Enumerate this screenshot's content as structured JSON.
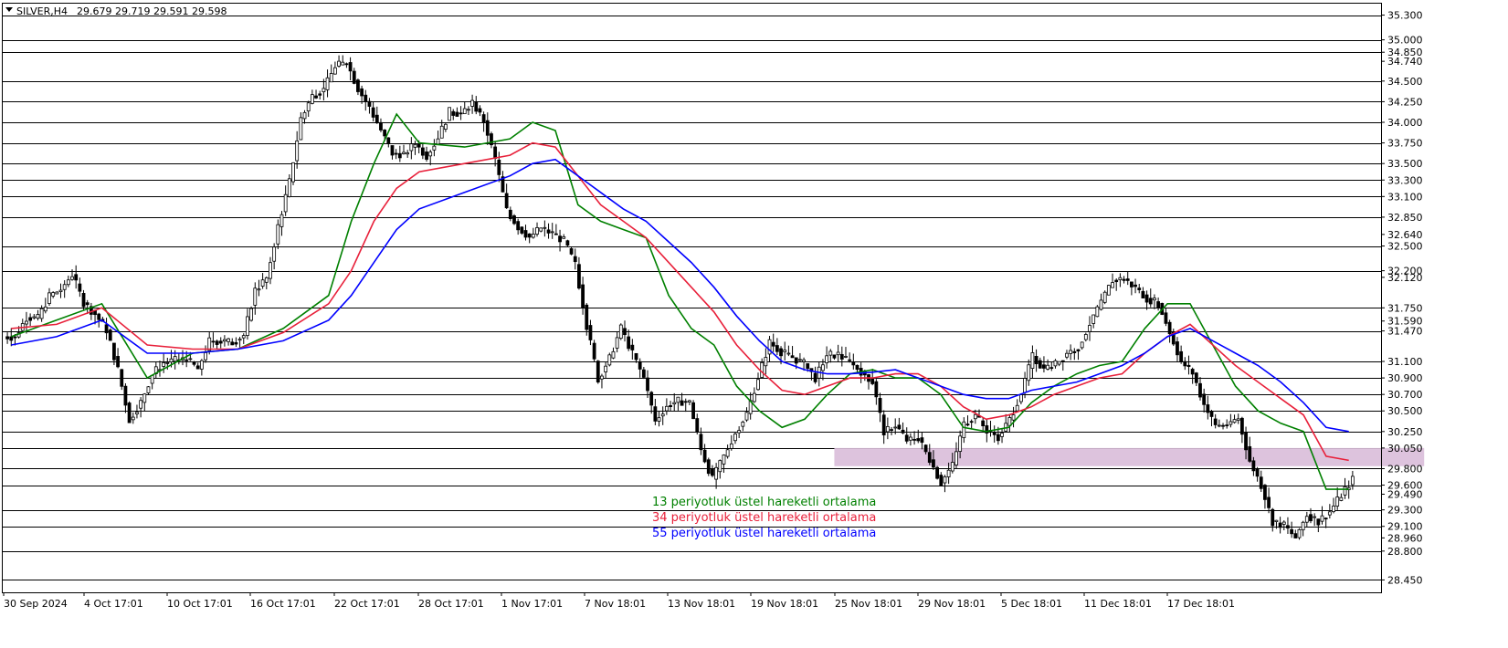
{
  "header": {
    "symbol": "SILVER,H4",
    "ohlc": "29.679 29.719 29.591 29.598"
  },
  "colors": {
    "ema13": "#008000",
    "ema34": "#e8203a",
    "ema55": "#0000ff",
    "zone": "#d9bcd9",
    "hline": "#000000",
    "candle": "#000000"
  },
  "chart_data": {
    "type": "candlestick",
    "symbol": "SILVER",
    "timeframe": "H4",
    "ylim": [
      28.3,
      35.45
    ],
    "x_tick_labels": [
      "30 Sep 2024",
      "4 Oct 17:01",
      "10 Oct 17:01",
      "16 Oct 17:01",
      "22 Oct 17:01",
      "28 Oct 17:01",
      "1 Nov 17:01",
      "7 Nov 18:01",
      "13 Nov 18:01",
      "19 Nov 18:01",
      "25 Nov 18:01",
      "29 Nov 18:01",
      "5 Dec 18:01",
      "11 Dec 18:01",
      "17 Dec 18:01"
    ],
    "y_tick_labels": [
      "35.300",
      "35.000",
      "34.850",
      "34.740",
      "34.500",
      "34.250",
      "34.000",
      "33.750",
      "33.500",
      "33.300",
      "33.100",
      "32.850",
      "32.640",
      "32.500",
      "32.200",
      "32.120",
      "31.750",
      "31.590",
      "31.470",
      "31.100",
      "30.900",
      "30.700",
      "30.500",
      "30.250",
      "30.050",
      "29.800",
      "29.600",
      "29.490",
      "29.300",
      "29.100",
      "28.960",
      "28.800",
      "28.450"
    ],
    "horizontal_levels": [
      35.3,
      35.0,
      34.85,
      34.5,
      34.25,
      34.0,
      33.75,
      33.5,
      33.3,
      33.1,
      32.85,
      32.5,
      32.2,
      31.75,
      31.47,
      31.1,
      30.9,
      30.7,
      30.5,
      30.25,
      30.05,
      29.8,
      29.6,
      29.3,
      29.1,
      28.8,
      28.45
    ],
    "zone": {
      "from_date": "13 Nov 2024",
      "to_date": "23 Dec 2024",
      "low": 29.83,
      "high": 30.05
    },
    "price_path": [
      [
        "30 Sep",
        31.4
      ],
      [
        "2 Oct",
        31.85
      ],
      [
        "4 Oct",
        32.0
      ],
      [
        "6 Oct",
        31.7
      ],
      [
        "8 Oct",
        30.3
      ],
      [
        "10 Oct",
        31.1
      ],
      [
        "12 Oct",
        31.15
      ],
      [
        "14 Oct",
        31.2
      ],
      [
        "16 Oct",
        31.6
      ],
      [
        "18 Oct",
        32.5
      ],
      [
        "20 Oct",
        34.2
      ],
      [
        "21 Oct",
        34.8
      ],
      [
        "22 Oct",
        34.5
      ],
      [
        "24 Oct",
        33.5
      ],
      [
        "26 Oct",
        33.6
      ],
      [
        "28 Oct",
        34.3
      ],
      [
        "29 Oct",
        34.0
      ],
      [
        "30 Oct",
        32.8
      ],
      [
        "1 Nov",
        32.6
      ],
      [
        "3 Nov",
        32.6
      ],
      [
        "5 Nov",
        31.0
      ],
      [
        "7 Nov",
        31.4
      ],
      [
        "9 Nov",
        30.5
      ],
      [
        "11 Nov",
        30.6
      ],
      [
        "13 Nov",
        29.75
      ],
      [
        "15 Nov",
        30.3
      ],
      [
        "17 Nov",
        31.3
      ],
      [
        "19 Nov",
        31.1
      ],
      [
        "21 Nov",
        31.0
      ],
      [
        "23 Nov",
        31.2
      ],
      [
        "25 Nov",
        30.2
      ],
      [
        "26 Nov",
        30.05
      ],
      [
        "27 Nov",
        29.75
      ],
      [
        "29 Nov",
        30.6
      ],
      [
        "1 Dec",
        30.1
      ],
      [
        "3 Dec",
        31.0
      ],
      [
        "5 Dec",
        31.3
      ],
      [
        "7 Dec",
        31.4
      ],
      [
        "9 Dec",
        32.1
      ],
      [
        "11 Dec",
        31.9
      ],
      [
        "12 Dec",
        31.2
      ],
      [
        "14 Dec",
        30.5
      ],
      [
        "16 Dec",
        30.3
      ],
      [
        "18 Dec",
        29.4
      ],
      [
        "20 Dec",
        28.9
      ],
      [
        "22 Dec",
        29.3
      ],
      [
        "23 Dec",
        29.6
      ]
    ],
    "series": [
      {
        "name": "13 periyotluk üstel hareketli ortalama",
        "color": "#008000",
        "period": 13,
        "values": [
          [
            0,
            31.4
          ],
          [
            4,
            31.6
          ],
          [
            8,
            31.8
          ],
          [
            12,
            30.9
          ],
          [
            16,
            31.2
          ],
          [
            20,
            31.25
          ],
          [
            24,
            31.5
          ],
          [
            28,
            31.9
          ],
          [
            30,
            32.8
          ],
          [
            32,
            33.5
          ],
          [
            34,
            34.1
          ],
          [
            36,
            33.75
          ],
          [
            40,
            33.7
          ],
          [
            44,
            33.8
          ],
          [
            46,
            34.0
          ],
          [
            48,
            33.9
          ],
          [
            50,
            33.0
          ],
          [
            52,
            32.8
          ],
          [
            54,
            32.7
          ],
          [
            56,
            32.6
          ],
          [
            58,
            31.9
          ],
          [
            60,
            31.5
          ],
          [
            62,
            31.3
          ],
          [
            64,
            30.8
          ],
          [
            66,
            30.5
          ],
          [
            68,
            30.3
          ],
          [
            70,
            30.4
          ],
          [
            72,
            30.7
          ],
          [
            74,
            30.95
          ],
          [
            76,
            31.0
          ],
          [
            78,
            30.9
          ],
          [
            80,
            30.9
          ],
          [
            82,
            30.7
          ],
          [
            84,
            30.3
          ],
          [
            86,
            30.25
          ],
          [
            88,
            30.3
          ],
          [
            90,
            30.6
          ],
          [
            92,
            30.8
          ],
          [
            94,
            30.95
          ],
          [
            96,
            31.05
          ],
          [
            98,
            31.1
          ],
          [
            100,
            31.5
          ],
          [
            102,
            31.8
          ],
          [
            104,
            31.8
          ],
          [
            106,
            31.3
          ],
          [
            108,
            30.8
          ],
          [
            110,
            30.5
          ],
          [
            112,
            30.35
          ],
          [
            114,
            30.25
          ],
          [
            116,
            29.55
          ],
          [
            118,
            29.55
          ]
        ]
      },
      {
        "name": "34 periyotluk üstel hareketli ortalama",
        "color": "#e8203a",
        "period": 34,
        "values": [
          [
            0,
            31.5
          ],
          [
            4,
            31.55
          ],
          [
            8,
            31.75
          ],
          [
            12,
            31.3
          ],
          [
            16,
            31.25
          ],
          [
            20,
            31.25
          ],
          [
            24,
            31.45
          ],
          [
            28,
            31.8
          ],
          [
            30,
            32.2
          ],
          [
            32,
            32.8
          ],
          [
            34,
            33.2
          ],
          [
            36,
            33.4
          ],
          [
            40,
            33.5
          ],
          [
            44,
            33.6
          ],
          [
            46,
            33.75
          ],
          [
            48,
            33.7
          ],
          [
            50,
            33.35
          ],
          [
            52,
            33.0
          ],
          [
            54,
            32.8
          ],
          [
            56,
            32.6
          ],
          [
            58,
            32.3
          ],
          [
            60,
            32.0
          ],
          [
            62,
            31.7
          ],
          [
            64,
            31.3
          ],
          [
            66,
            31.0
          ],
          [
            68,
            30.75
          ],
          [
            70,
            30.7
          ],
          [
            72,
            30.8
          ],
          [
            74,
            30.9
          ],
          [
            76,
            30.9
          ],
          [
            78,
            30.95
          ],
          [
            80,
            30.95
          ],
          [
            82,
            30.8
          ],
          [
            84,
            30.55
          ],
          [
            86,
            30.4
          ],
          [
            88,
            30.45
          ],
          [
            90,
            30.55
          ],
          [
            92,
            30.7
          ],
          [
            94,
            30.8
          ],
          [
            96,
            30.9
          ],
          [
            98,
            30.95
          ],
          [
            100,
            31.2
          ],
          [
            102,
            31.4
          ],
          [
            104,
            31.55
          ],
          [
            106,
            31.3
          ],
          [
            108,
            31.05
          ],
          [
            110,
            30.85
          ],
          [
            112,
            30.65
          ],
          [
            114,
            30.45
          ],
          [
            116,
            29.95
          ],
          [
            118,
            29.9
          ]
        ]
      },
      {
        "name": "55 periyotluk üstel hareketli ortalama",
        "color": "#0000ff",
        "period": 55,
        "values": [
          [
            0,
            31.3
          ],
          [
            4,
            31.4
          ],
          [
            8,
            31.6
          ],
          [
            12,
            31.2
          ],
          [
            16,
            31.2
          ],
          [
            20,
            31.25
          ],
          [
            24,
            31.35
          ],
          [
            28,
            31.6
          ],
          [
            30,
            31.9
          ],
          [
            32,
            32.3
          ],
          [
            34,
            32.7
          ],
          [
            36,
            32.95
          ],
          [
            40,
            33.15
          ],
          [
            44,
            33.35
          ],
          [
            46,
            33.5
          ],
          [
            48,
            33.55
          ],
          [
            50,
            33.35
          ],
          [
            52,
            33.15
          ],
          [
            54,
            32.95
          ],
          [
            56,
            32.8
          ],
          [
            58,
            32.55
          ],
          [
            60,
            32.3
          ],
          [
            62,
            32.0
          ],
          [
            64,
            31.65
          ],
          [
            66,
            31.35
          ],
          [
            68,
            31.1
          ],
          [
            70,
            31.0
          ],
          [
            72,
            30.95
          ],
          [
            74,
            30.95
          ],
          [
            76,
            30.97
          ],
          [
            78,
            31.0
          ],
          [
            80,
            30.9
          ],
          [
            82,
            30.8
          ],
          [
            84,
            30.7
          ],
          [
            86,
            30.65
          ],
          [
            88,
            30.65
          ],
          [
            90,
            30.75
          ],
          [
            92,
            30.8
          ],
          [
            94,
            30.85
          ],
          [
            96,
            30.95
          ],
          [
            98,
            31.05
          ],
          [
            100,
            31.2
          ],
          [
            102,
            31.4
          ],
          [
            104,
            31.5
          ],
          [
            106,
            31.35
          ],
          [
            108,
            31.2
          ],
          [
            110,
            31.05
          ],
          [
            112,
            30.85
          ],
          [
            114,
            30.6
          ],
          [
            116,
            30.3
          ],
          [
            118,
            30.25
          ]
        ]
      }
    ],
    "legend": [
      "13 periyotluk üstel hareketli ortalama",
      "34 periyotluk üstel hareketli ortalama",
      "55 periyotluk üstel hareketli ortalama"
    ],
    "legend_placement": "bottom-center",
    "grid": false
  }
}
